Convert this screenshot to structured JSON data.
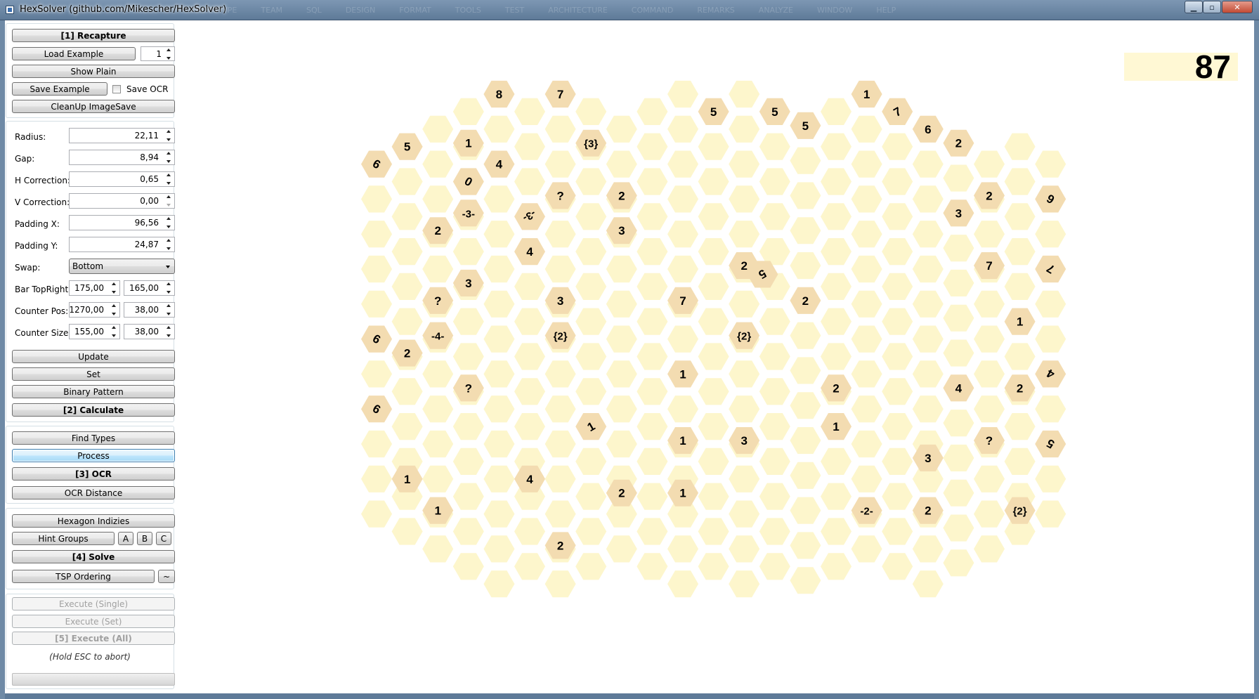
{
  "window": {
    "title": "HexSolver (github.com/Mikescher/HexSolver)",
    "background_menu": [
      "PROTOTYPE",
      "TEAM",
      "SQL",
      "DESIGN",
      "FORMAT",
      "TOOLS",
      "TEST",
      "ARCHITECTURE",
      "COMMAND",
      "REMARKS",
      "ANALYZE",
      "WINDOW",
      "HELP"
    ],
    "minimize_label": "▁",
    "maximize_label": "▫",
    "close_label": "✕"
  },
  "panel1": {
    "recapture": "[1] Recapture",
    "load_example": "Load Example",
    "example_index": "1",
    "show_plain": "Show Plain",
    "save_example": "Save Example",
    "save_ocr": "Save OCR",
    "cleanup": "CleanUp ImageSave"
  },
  "panel2": {
    "radius_label": "Radius:",
    "radius": "22,11",
    "gap_label": "Gap:",
    "gap": "8,94",
    "hcorr_label": "H Correction:",
    "hcorr": "0,65",
    "vcorr_label": "V Correction:",
    "vcorr": "0,00",
    "padx_label": "Padding X:",
    "padx": "96,56",
    "pady_label": "Padding Y:",
    "pady": "24,87",
    "swap_label": "Swap:",
    "swap": "Bottom",
    "bar_label": "Bar TopRight:",
    "bar_x": "175,00",
    "bar_y": "165,00",
    "cpos_label": "Counter Pos:",
    "cpos_x": "1270,00",
    "cpos_y": "38,00",
    "csize_label": "Counter Size:",
    "csize_x": "155,00",
    "csize_y": "38,00",
    "update": "Update",
    "set": "Set",
    "binary_pattern": "Binary Pattern",
    "calculate": "[2] Calculate"
  },
  "panel3": {
    "find_types": "Find Types",
    "process": "Process",
    "ocr": "[3] OCR",
    "ocr_distance": "OCR Distance"
  },
  "panel4": {
    "hex_indizies": "Hexagon Indizies",
    "hint_groups": "Hint Groups",
    "a": "A",
    "b": "B",
    "c": "C",
    "solve": "[4] Solve",
    "tsp": "TSP Ordering",
    "tilde": "~"
  },
  "panel5": {
    "exec_single": "Execute (Single)",
    "exec_set": "Execute (Set)",
    "exec_all": "[5] Execute (All)",
    "hold_esc": "(Hold ESC to abort)"
  },
  "counter": {
    "value": "87"
  },
  "board": {
    "colors": {
      "empty": "#fdf6cc",
      "revealed": "#f3dcb1",
      "text": "#000000"
    },
    "grid": {
      "columns": 23,
      "rows": 15,
      "first_column_index": 12.4,
      "row_origin": 2.6,
      "column_index_step": 1,
      "row_step": 1
    },
    "numbered_cells": [
      [
        "4.0",
        "2.6",
        "8",
        "r",
        0
      ],
      [
        "6.0",
        "2.6",
        "7",
        "r",
        0
      ],
      [
        "11.0",
        "3.6",
        "5",
        "r",
        0
      ],
      [
        "13.0",
        "3.6",
        "5",
        "r",
        0
      ],
      [
        "14.0",
        "4.4",
        "5",
        "r",
        0
      ],
      [
        "16.0",
        "2.6",
        "1",
        "r",
        0
      ],
      [
        "17.0",
        "3.6",
        "7",
        "r",
        -30
      ],
      [
        "18.0",
        "4.6",
        "6",
        "r",
        0
      ],
      [
        "19.0",
        "5.4",
        "2",
        "r",
        0
      ],
      [
        "1.0",
        "5.6",
        "5",
        "r",
        0
      ],
      [
        "0.0",
        "6.6",
        "9",
        "r",
        -150
      ],
      [
        "3.0",
        "5.4",
        "1",
        "r",
        0
      ],
      [
        "4.0",
        "6.6",
        "4",
        "r",
        0
      ],
      [
        "7.0",
        "5.4",
        "{3}",
        "r",
        0
      ],
      [
        "3.0",
        "7.6",
        "0",
        "r",
        -150
      ],
      [
        "6.0",
        "8.4",
        "?",
        "r",
        0
      ],
      [
        "8.0",
        "8.4",
        "2",
        "r",
        0
      ],
      [
        "20.0",
        "8.4",
        "2",
        "r",
        0
      ],
      [
        "22.0",
        "8.6",
        "6",
        "r",
        -150
      ],
      [
        "3.0",
        "9.4",
        "-3-",
        "r",
        0
      ],
      [
        "5.0",
        "9.6",
        "-3-",
        "r",
        150
      ],
      [
        "2.0",
        "10.4",
        "2",
        "r",
        0
      ],
      [
        "8.0",
        "10.4",
        "3",
        "r",
        0
      ],
      [
        "19.0",
        "9.4",
        "3",
        "r",
        0
      ],
      [
        "5.0",
        "11.6",
        "4",
        "r",
        0
      ],
      [
        "12.0",
        "12.4",
        "2",
        "r",
        0
      ],
      [
        "12.6",
        "12.9",
        "5",
        "r",
        150
      ],
      [
        "20.0",
        "12.4",
        "7",
        "r",
        0
      ],
      [
        "22.0",
        "12.6",
        "7",
        "r",
        -150
      ],
      [
        "3.0",
        "13.4",
        "3",
        "r",
        0
      ],
      [
        "2.0",
        "14.4",
        "?",
        "r",
        0
      ],
      [
        "6.0",
        "14.4",
        "3",
        "r",
        0
      ],
      [
        "10.0",
        "14.4",
        "7",
        "r",
        0
      ],
      [
        "14.0",
        "14.4",
        "2",
        "r",
        0
      ],
      [
        "21.0",
        "15.6",
        "1",
        "r",
        0
      ],
      [
        "0.0",
        "16.6",
        "9",
        "r",
        -150
      ],
      [
        "1.0",
        "17.4",
        "2",
        "r",
        0
      ],
      [
        "2.0",
        "16.4",
        "-4-",
        "r",
        0
      ],
      [
        "6.0",
        "16.4",
        "{2}",
        "r",
        0
      ],
      [
        "12.0",
        "16.4",
        "{2}",
        "r",
        0
      ],
      [
        "10.0",
        "18.6",
        "1",
        "r",
        0
      ],
      [
        "22.0",
        "18.6",
        "4",
        "r",
        -150
      ],
      [
        "3.0",
        "19.4",
        "?",
        "r",
        0
      ],
      [
        "15.0",
        "19.4",
        "2",
        "r",
        0
      ],
      [
        "19.0",
        "19.4",
        "4",
        "r",
        0
      ],
      [
        "21.0",
        "19.4",
        "2",
        "r",
        0
      ],
      [
        "0.0",
        "20.6",
        "9",
        "r",
        -150
      ],
      [
        "7.0",
        "21.6",
        "1",
        "r",
        -30
      ],
      [
        "15.0",
        "21.6",
        "1",
        "r",
        0
      ],
      [
        "10.0",
        "22.4",
        "1",
        "r",
        0
      ],
      [
        "12.0",
        "22.4",
        "3",
        "r",
        0
      ],
      [
        "20.0",
        "22.4",
        "?",
        "r",
        0
      ],
      [
        "22.0",
        "22.6",
        "5",
        "r",
        -150
      ],
      [
        "18.0",
        "23.4",
        "3",
        "r",
        0
      ],
      [
        "1.0",
        "24.6",
        "1",
        "r",
        0
      ],
      [
        "5.0",
        "24.6",
        "4",
        "r",
        0
      ],
      [
        "8.0",
        "25.4",
        "2",
        "r",
        0
      ],
      [
        "10.0",
        "25.4",
        "1",
        "r",
        0
      ],
      [
        "21.0",
        "26.4",
        "{2}",
        "r",
        0
      ],
      [
        "2.0",
        "26.4",
        "1",
        "r",
        0
      ],
      [
        "16.0",
        "26.4",
        "-2-",
        "r",
        0
      ],
      [
        "18.0",
        "26.4",
        "2",
        "r",
        0
      ],
      [
        "6.0",
        "28.4",
        "2",
        "r",
        0
      ]
    ]
  }
}
